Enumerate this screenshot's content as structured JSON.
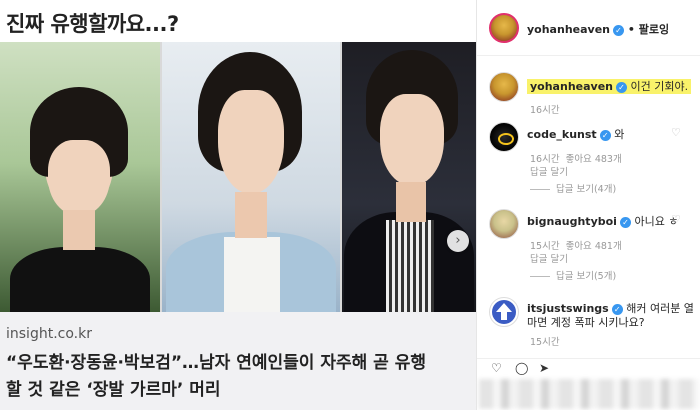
{
  "article": {
    "top_title": "진짜 유행할까요...?",
    "source": "insight.co.kr",
    "headline_line1": "“우도환·장동윤·박보검”…남자 연예인들이 자주해 곧 유행",
    "headline_line2": "할 것 같은 ‘장발 가르마’ 머리",
    "next_arrow": "›"
  },
  "instagram": {
    "header": {
      "username": "yohanheaven",
      "follow_label": "• 팔로잉"
    },
    "caption": {
      "username": "yohanheaven",
      "text": "이건 기회야.",
      "time": "16시간"
    },
    "comments": [
      {
        "username": "code_kunst",
        "text": "와",
        "time": "16시간",
        "likes": "좋아요 483개",
        "reply": "답글 달기",
        "view_replies": "답글 보기(4개)"
      },
      {
        "username": "bignaughtyboi",
        "text": "아니요 ㅎ",
        "time": "15시간",
        "likes": "좋아요 481개",
        "reply": "답글 달기",
        "view_replies": "답글 보기(5개)"
      },
      {
        "username": "itsjustswings",
        "text_line1": "해커 여러분 열",
        "text_line2": "마면 계정 폭파 시키나요?",
        "time": "15시간"
      }
    ],
    "colors": {
      "verified": "#3897f0",
      "highlight": "#f9f26a",
      "story_ring": "#e1306c"
    }
  }
}
